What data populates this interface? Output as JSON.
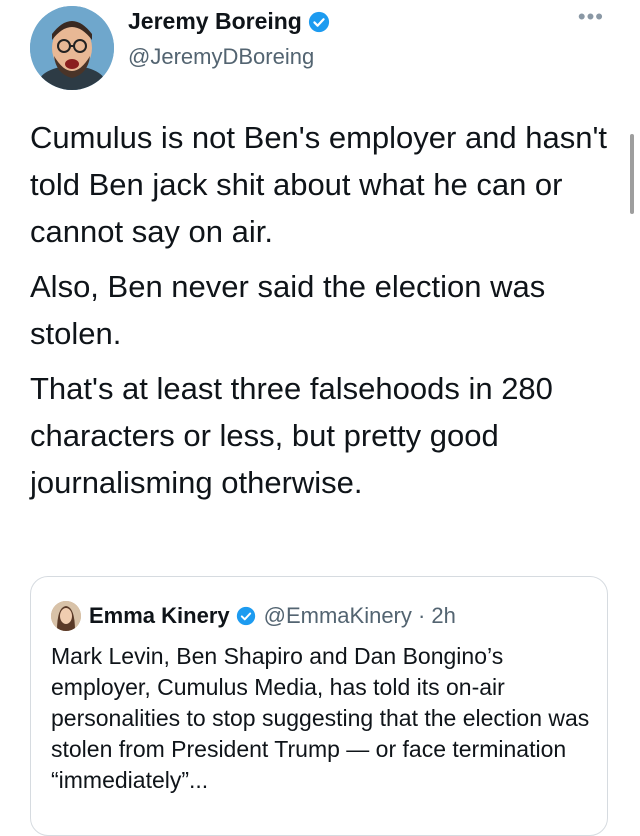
{
  "author": {
    "name": "Jeremy Boreing",
    "handle": "@JeremyDBoreing",
    "verified": true,
    "more_label": "•••"
  },
  "tweet": {
    "paragraphs": [
      "Cumulus is not Ben's employer and hasn't told Ben jack shit about what he can or cannot say on air.",
      "Also, Ben never said the election was stolen.",
      "That's at least three falsehoods in 280 characters or less, but pretty good journalisming otherwise."
    ]
  },
  "quoted_tweet": {
    "name": "Emma Kinery",
    "verified": true,
    "handle_time": "@EmmaKinery · 2h",
    "text": "Mark Levin, Ben Shapiro and Dan Bongino’s employer, Cumulus Media, has told its on-air personalities to stop suggesting that the election was stolen from President Trump — or face termination “immediately”..."
  },
  "colors": {
    "accent": "#1d9bf0",
    "text": "#0f1419",
    "secondary": "#536471",
    "border": "#d6dbe0"
  }
}
